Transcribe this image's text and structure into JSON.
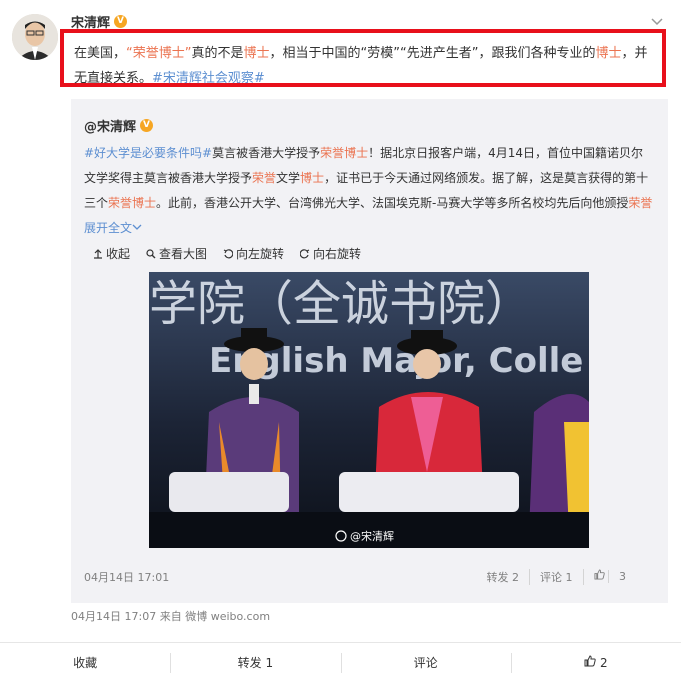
{
  "post": {
    "username": "宋清辉",
    "badge": "V",
    "text_parts": [
      "在美国，",
      "“荣誉博士”",
      "真的不是",
      "博士",
      "，相当于中国的“劳模”“先进产生者”，跟我们各种专业的",
      "博士",
      "，并无直接关系。",
      "#宋清辉社会观察#"
    ],
    "time": "04月14日 17:07",
    "source_prefix": "来自",
    "source": "微博 weibo.com"
  },
  "quoted": {
    "username": "@宋清辉",
    "badge": "V",
    "text_parts": [
      "#好大学是必要条件吗#",
      "莫言被香港大学授予",
      "荣誉博士",
      "！据北京日报客户端，4月14日，首位中国籍诺贝尔文学奖得主莫言被香港大学授予",
      "荣誉",
      "文学",
      "博士",
      "，证书已于今天通过网络颁发。据了解，这是莫言获得的第十三个",
      "荣誉博士",
      "。此前，香港公开大学、台湾佛光大学、法国埃克斯-马赛大学等多所名校均先后向他颁授",
      "荣誉",
      "展开全文"
    ],
    "tools": [
      "收起",
      "查看大图",
      "向左旋转",
      "向右旋转"
    ],
    "time": "04月14日 17:01",
    "actions": [
      "转发 2",
      "评论 1",
      "3"
    ],
    "photo": {
      "banner_text": "学院（全诚书院）",
      "sub_text": "English Major, Colle",
      "watermark": "@宋清辉"
    }
  },
  "bottom": [
    "收藏",
    "转发 1",
    "评论",
    "2"
  ],
  "icons": [
    "chevron-down-icon",
    "thumb-up-icon",
    "search-icon",
    "rotate-left-icon",
    "rotate-right-icon",
    "weibo-logo-icon"
  ]
}
